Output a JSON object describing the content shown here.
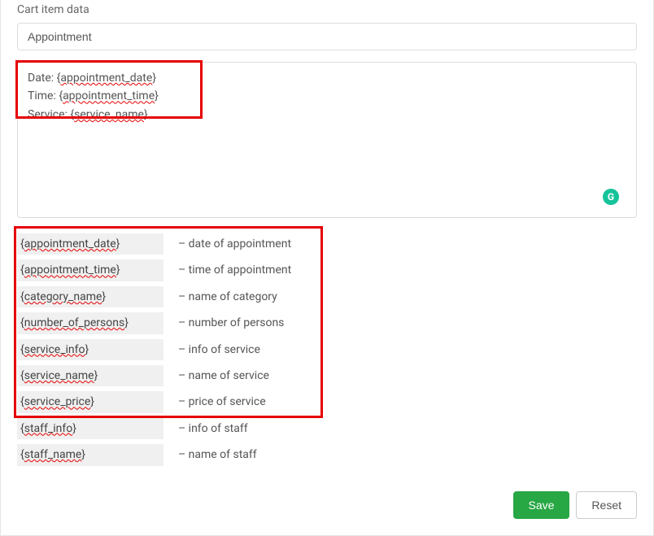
{
  "section_title": "Cart item data",
  "title_input_value": "Appointment",
  "textarea_value": "Date: {appointment_date}\nTime: {appointment_time}\nService: {service_name}",
  "textarea_line1_prefix": "Date: {",
  "textarea_line1_token": "appointment_date",
  "textarea_line1_suffix": "}",
  "textarea_line2_prefix": "Time: {",
  "textarea_line2_token": "appointment_time",
  "textarea_line2_suffix": "}",
  "textarea_line3_prefix": "Service: {",
  "textarea_line3_token": "service_name",
  "textarea_line3_suffix": "}",
  "placeholders": [
    {
      "key": "{appointment_date}",
      "desc": "– date of appointment"
    },
    {
      "key": "{appointment_time}",
      "desc": "– time of appointment"
    },
    {
      "key": "{category_name}",
      "desc": "– name of category"
    },
    {
      "key": "{number_of_persons}",
      "desc": "– number of persons"
    },
    {
      "key": "{service_info}",
      "desc": "– info of service"
    },
    {
      "key": "{service_name}",
      "desc": "– name of service"
    },
    {
      "key": "{service_price}",
      "desc": "– price of service"
    },
    {
      "key": "{staff_info}",
      "desc": "– info of staff"
    },
    {
      "key": "{staff_name}",
      "desc": "– name of staff"
    }
  ],
  "buttons": {
    "save": "Save",
    "reset": "Reset"
  }
}
